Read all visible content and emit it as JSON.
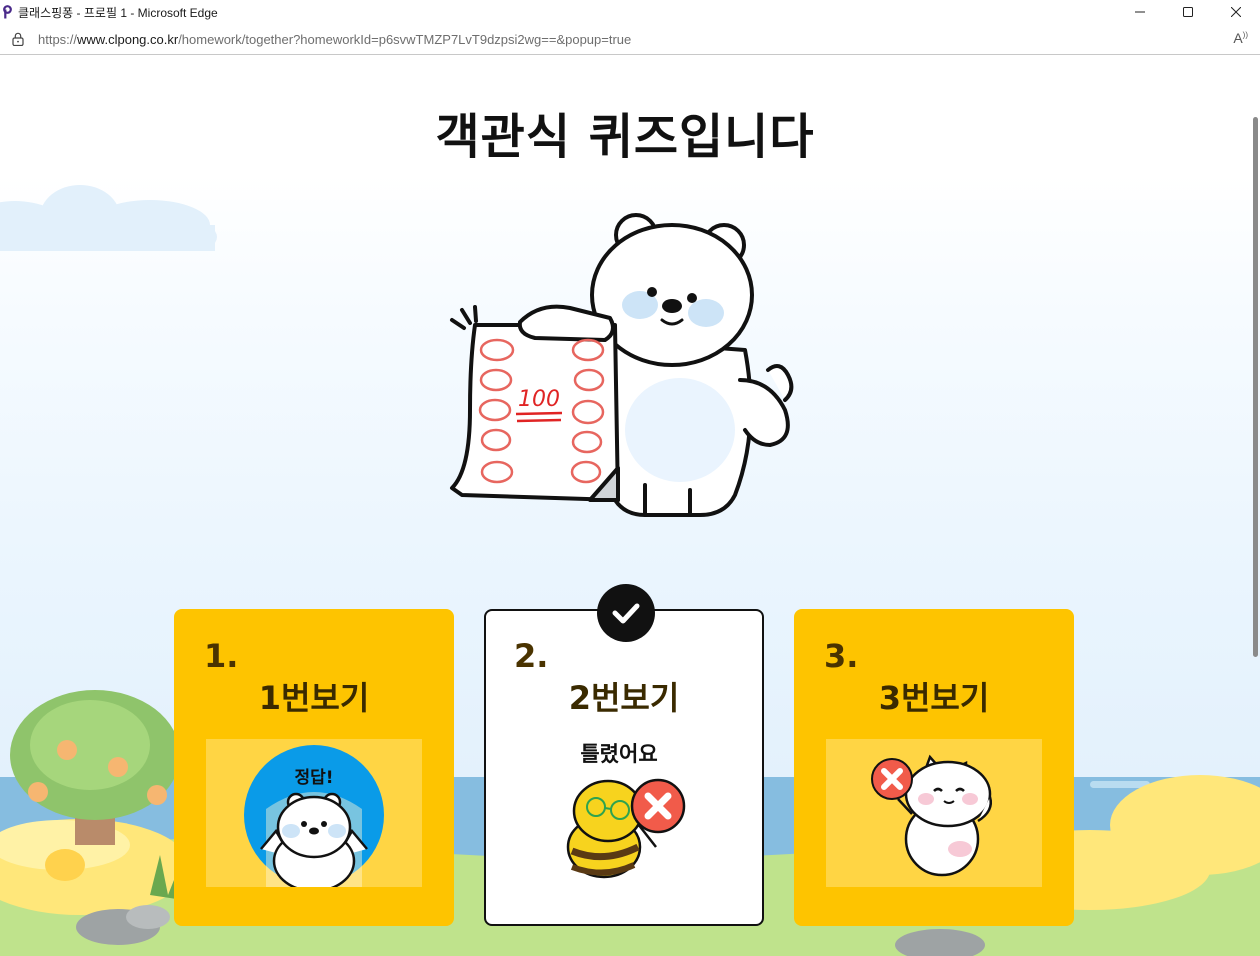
{
  "window": {
    "title": "클래스핑퐁 - 프로필 1 - Microsoft Edge",
    "controls": [
      "minimize",
      "maximize",
      "close"
    ]
  },
  "address": {
    "protocol": "https://",
    "host": "www.clpong.co.kr",
    "path": "/homework/together?homeworkId=p6svwTMZP7LvT9dzpsi2wg==&popup=true"
  },
  "page": {
    "headline": "객관식 퀴즈입니다",
    "hero_sheet_text": "100"
  },
  "options": [
    {
      "number": "1.",
      "label": "1번보기",
      "sticker_text": "정답!",
      "selected": false
    },
    {
      "number": "2.",
      "label": "2번보기",
      "sticker_text": "틀렸어요",
      "selected": true
    },
    {
      "number": "3.",
      "label": "3번보기",
      "sticker_text": "",
      "selected": false
    }
  ],
  "colors": {
    "card": "#fec400",
    "card_image_bg": "#ffd544",
    "selected_border": "#111111",
    "wrong_badge": "#f15b4a"
  }
}
